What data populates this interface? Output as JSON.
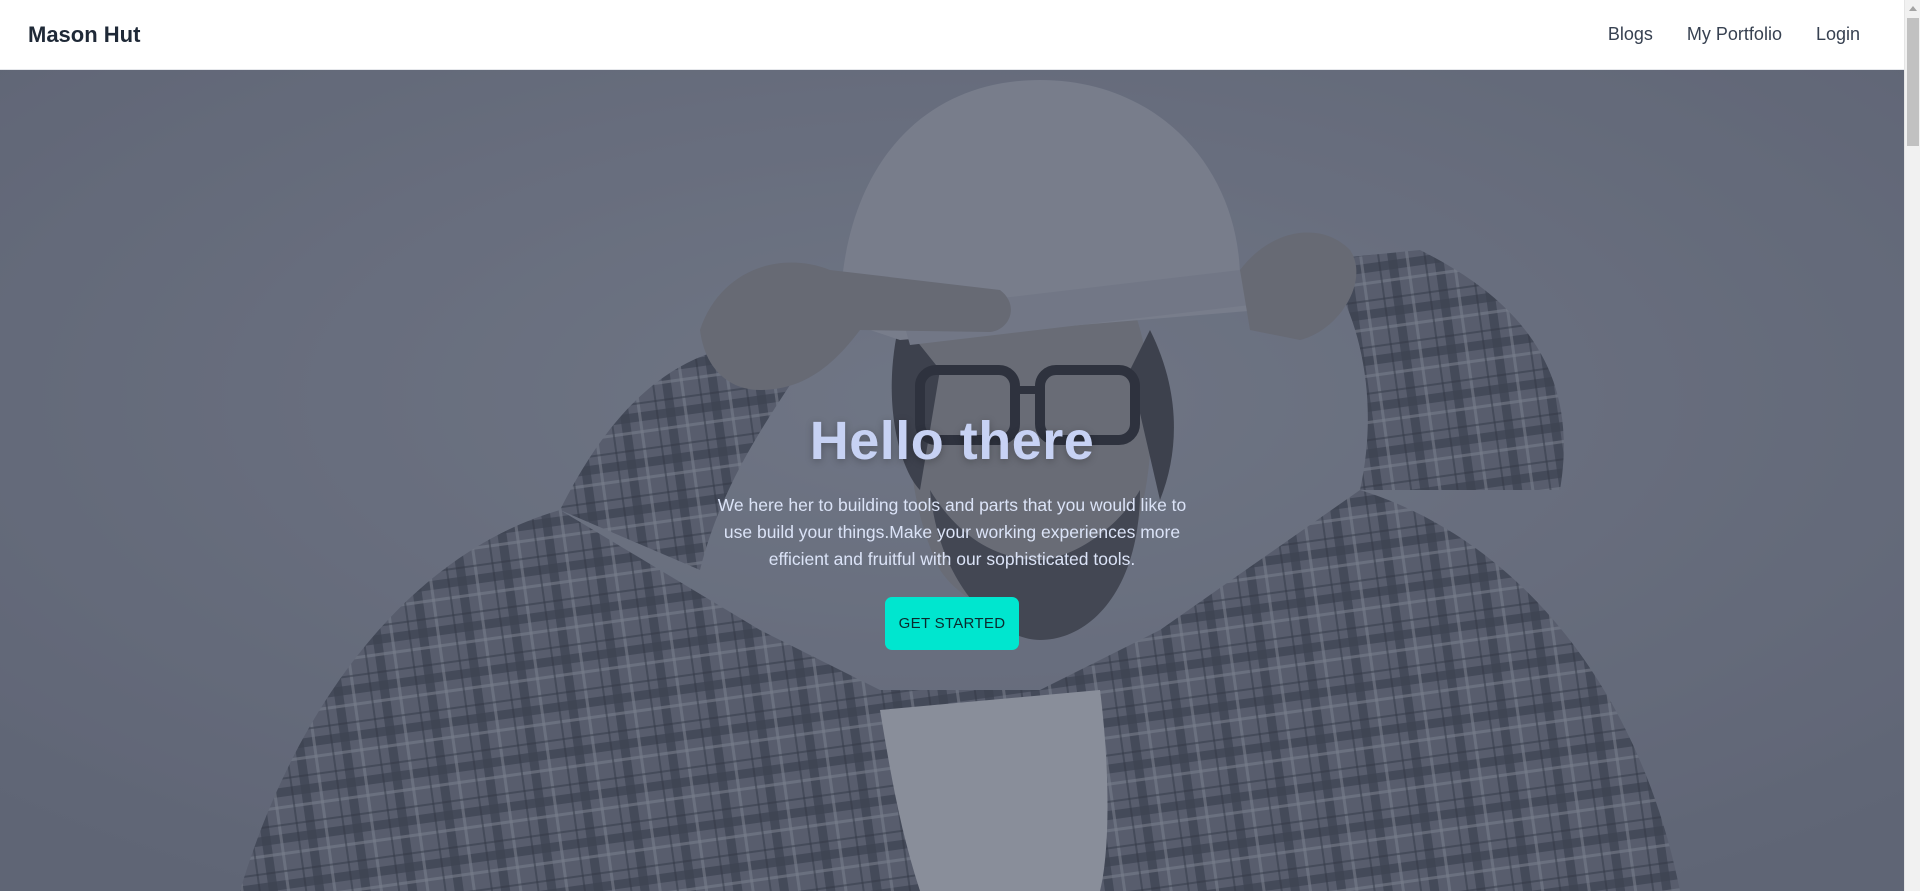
{
  "navbar": {
    "brand": "Mason Hut",
    "links": [
      "Blogs",
      "My Portfolio",
      "Login"
    ]
  },
  "hero": {
    "title": "Hello there",
    "description": "We here her to building tools and parts that you would like to use build your things.Make your working experiences more efficient and fruitful with our sophisticated tools.",
    "cta_label": "GET STARTED",
    "image": "hero-photo-worker-in-hard-hat-and-plaid-shirt"
  },
  "colors": {
    "accent": "#00e6cf",
    "title": "#c7d2f4",
    "overlay": "#3c4254"
  }
}
